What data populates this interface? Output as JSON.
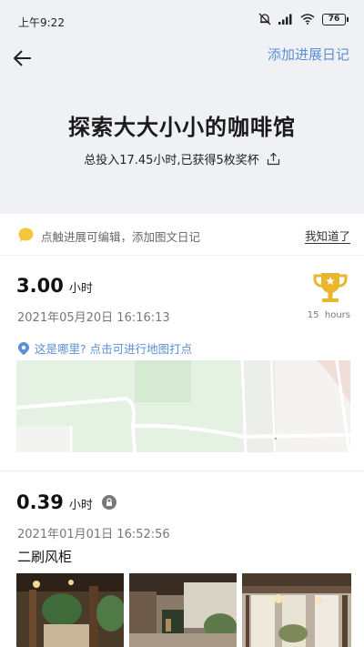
{
  "status_bar": {
    "time": "上午9:22",
    "battery": "76"
  },
  "header": {
    "add_diary_label": "添加进展日记",
    "title": "探索大大小小的咖啡馆",
    "summary": "总投入17.45小时,已获得5枚奖杯"
  },
  "tip": {
    "text": "点触进展可编辑，添加图文日记",
    "dismiss_label": "我知道了"
  },
  "entries": [
    {
      "hours": "3.00",
      "unit": "小时",
      "datetime": "2021年05月20日 16:16:13",
      "trophy_label": "15  hours",
      "location_prompt": "这是哪里? 点击可进行地图打点"
    },
    {
      "hours": "0.39",
      "unit": "小时",
      "datetime": "2021年01月01日 16:52:56",
      "text": "二刷风柜"
    }
  ],
  "colors": {
    "accent": "#5b8fd6",
    "trophy": "#e9b62d",
    "bubble": "#f4c63d"
  }
}
